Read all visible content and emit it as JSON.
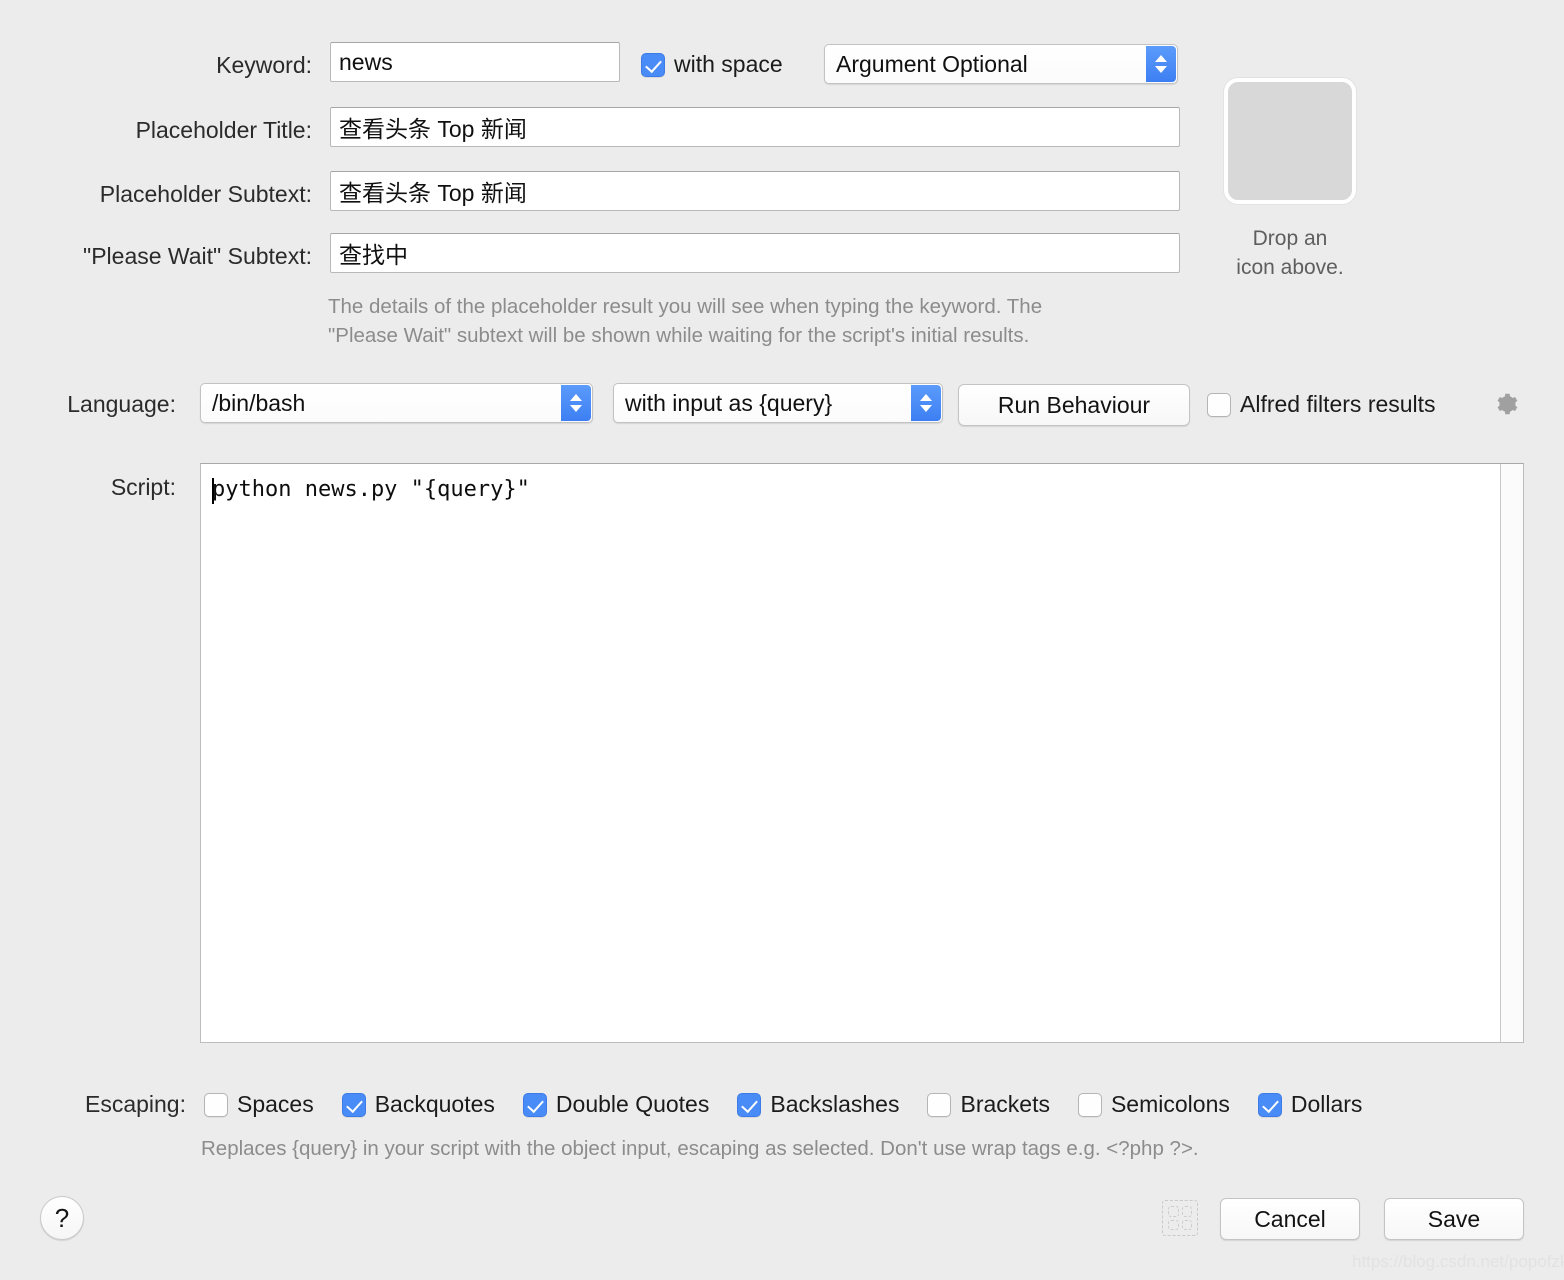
{
  "form": {
    "keyword": {
      "label": "Keyword:",
      "value": "news",
      "placeholder": "",
      "with_space_label": "with space",
      "with_space_checked": true,
      "argument_mode": "Argument Optional"
    },
    "placeholder_title": {
      "label": "Placeholder Title:",
      "value": "查看头条 Top 新闻"
    },
    "placeholder_subtext": {
      "label": "Placeholder Subtext:",
      "value": "查看头条 Top 新闻"
    },
    "please_wait_subtext": {
      "label": "\"Please Wait\" Subtext:",
      "value": "查找中"
    },
    "placeholder_help_line1": "The details of the placeholder result you will see when typing the keyword. The",
    "placeholder_help_line2": "\"Please Wait\" subtext will be shown while waiting for the script's initial results."
  },
  "icon_well": {
    "caption_line1": "Drop an",
    "caption_line2": "icon above."
  },
  "language_row": {
    "label": "Language:",
    "language": "/bin/bash",
    "input_mode": "with input as {query}",
    "run_behaviour_label": "Run Behaviour",
    "alfred_filters_label": "Alfred filters results",
    "alfred_filters_checked": false
  },
  "script": {
    "label": "Script:",
    "code": "python news.py \"{query}\""
  },
  "escaping": {
    "label": "Escaping:",
    "options": [
      {
        "label": "Spaces",
        "checked": false
      },
      {
        "label": "Backquotes",
        "checked": true
      },
      {
        "label": "Double Quotes",
        "checked": true
      },
      {
        "label": "Backslashes",
        "checked": true
      },
      {
        "label": "Brackets",
        "checked": false
      },
      {
        "label": "Semicolons",
        "checked": false
      },
      {
        "label": "Dollars",
        "checked": true
      }
    ],
    "help": "Replaces {query} in your script with the object input, escaping as selected. Don't use wrap tags e.g. <?php ?>."
  },
  "footer": {
    "help_label": "?",
    "cancel_label": "Cancel",
    "save_label": "Save"
  },
  "watermark": "https://blog.csdn.net/popofzk",
  "colors": {
    "accent": "#4a8cf7",
    "window_bg": "#ececec",
    "help_text": "#8c8c8c"
  }
}
